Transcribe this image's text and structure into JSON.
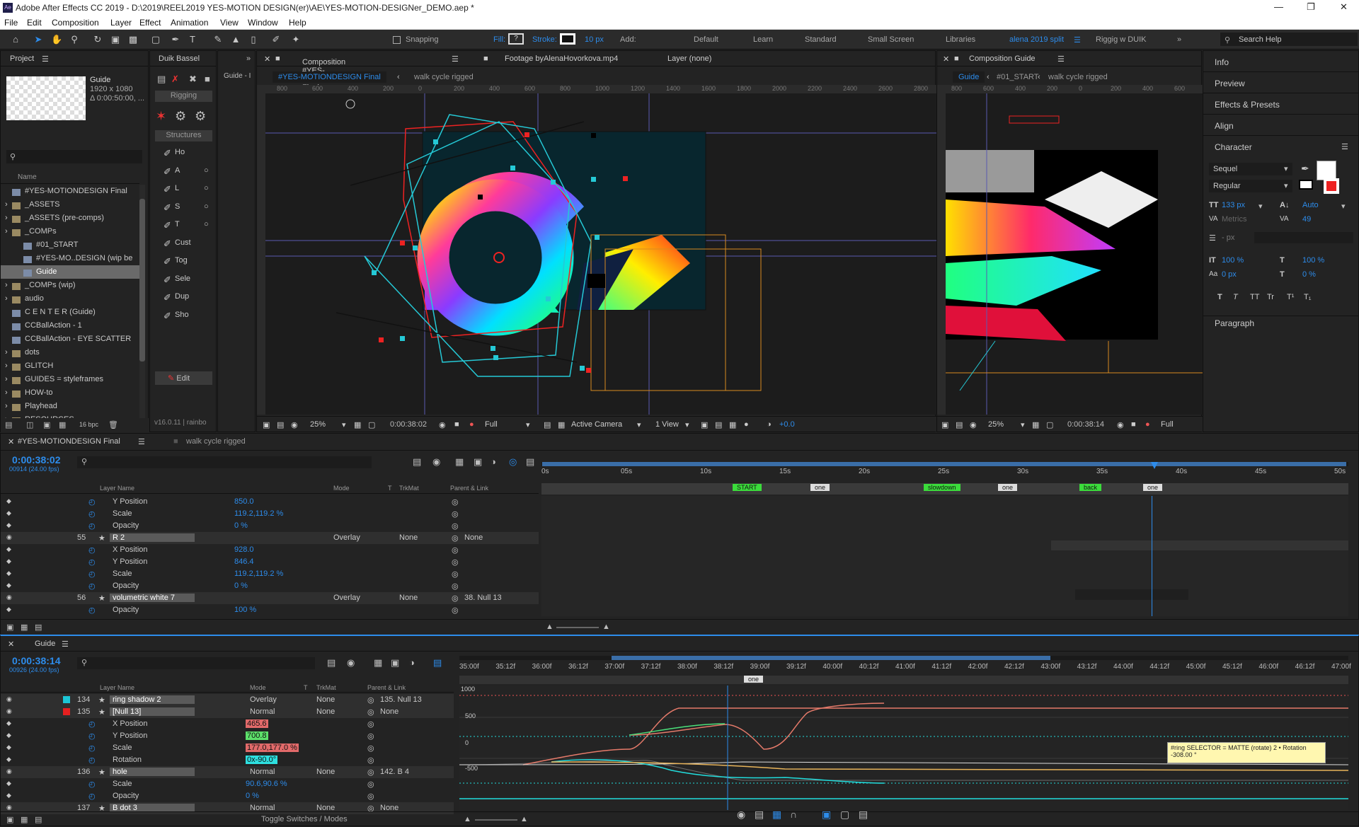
{
  "window": {
    "title": "Adobe After Effects CC 2019 - D:\\2019\\REEL2019 YES-MOTION DESIGN(er)\\AE\\YES-MOTION-DESIGNer_DEMO.aep *"
  },
  "menu": [
    "File",
    "Edit",
    "Composition",
    "Layer",
    "Effect",
    "Animation",
    "View",
    "Window",
    "Help"
  ],
  "toolbar": {
    "snapping": "Snapping",
    "fill": "Fill:",
    "stroke": "Stroke:",
    "stroke_px": "10 px",
    "add": "Add:",
    "workspaces": [
      "Default",
      "Learn",
      "Standard",
      "Small Screen",
      "Libraries",
      "alena 2019 split",
      "Riggig w DUIK"
    ],
    "search": "Search Help"
  },
  "project": {
    "title": "Project",
    "thumb_name": "Guide",
    "thumb_size": "1920 x 1080",
    "thumb_dur": "Δ 0:00:50:00, ...",
    "col_name": "Name",
    "items": [
      "#YES-MOTIONDESIGN Final",
      "_ASSETS",
      "_ASSETS (pre-comps)",
      "_COMPs",
      "#01_START",
      "#YES-MO..DESIGN (wip be",
      "Guide",
      "_COMPs (wip)",
      "audio",
      "C E N T E R (Guide)",
      "CCBallAction - 1",
      "CCBallAction - EYE  SCATTER",
      "dots",
      "GLITCH",
      "GUIDES = styleframes",
      "HOW-to",
      "Playhead",
      "RESOURCES"
    ],
    "bpc": "16 bpc"
  },
  "duik": {
    "title": "Duik Bassel",
    "rigging": "Rigging",
    "structures": "Structures",
    "tools": [
      "Ho",
      "A",
      "L",
      "S",
      "T",
      "Cust",
      "Tog",
      "Sele",
      "Dup",
      "Sho"
    ],
    "edit": "Edit",
    "version": "v16.0.11 | rainbo"
  },
  "guide_tab": "Guide - I",
  "comp_main": {
    "tabs": [
      "Composition #YES-MOTIONDESIGN Final",
      "Footage byAlenaHovorkova.mp4",
      "Layer (none)"
    ],
    "breadcrumbs": [
      "#YES-MOTIONDESIGN Final",
      "walk cycle rigged"
    ],
    "ruler": [
      "800",
      "600",
      "400",
      "200",
      "0",
      "200",
      "400",
      "600",
      "800",
      "1000",
      "1200",
      "1400",
      "1600",
      "1800",
      "2000",
      "2200",
      "2400",
      "2600",
      "2800"
    ],
    "zoom": "25%",
    "time": "0:00:38:02",
    "res": "Full",
    "camera": "Active Camera",
    "view": "1 View",
    "exposure": "+0.0"
  },
  "comp_guide": {
    "tab": "Composition Guide",
    "breadcrumbs": [
      "Guide",
      "#01_START",
      "walk cycle rigged"
    ],
    "ruler": [
      "800",
      "600",
      "400",
      "200",
      "0",
      "200",
      "400",
      "600"
    ],
    "zoom": "25%",
    "time": "0:00:38:14",
    "res": "Full"
  },
  "right_panels": {
    "items": [
      "Info",
      "Preview",
      "Effects & Presets",
      "Align",
      "Character"
    ],
    "font": "Sequel",
    "style": "Regular",
    "size": "133 px",
    "leading": "Auto",
    "metrics": "Metrics",
    "tracking": "49",
    "px": "- px",
    "vscale": "100 %",
    "hscale": "100 %",
    "baseline": "0 px",
    "tsume": "0 %",
    "styles": [
      "T",
      "T",
      "TT",
      "Tr",
      "T¹",
      "T₁"
    ],
    "paragraph": "Paragraph"
  },
  "timeline1": {
    "tab": "#YES-MOTIONDESIGN Final",
    "tab2": "walk cycle rigged",
    "time": "0:00:38:02",
    "frames": "00914 (24.00 fps)",
    "headers": {
      "name": "Layer Name",
      "mode": "Mode",
      "t": "T",
      "trk": "TrkMat",
      "parent": "Parent & Link"
    },
    "ruler": [
      "0s",
      "05s",
      "10s",
      "15s",
      "20s",
      "25s",
      "30s",
      "35s",
      "40s",
      "45s",
      "50s"
    ],
    "markers": [
      "START",
      "one",
      "slowdown",
      "one",
      "back",
      "one"
    ],
    "rows": [
      {
        "name": "Y Position",
        "value": "850.0"
      },
      {
        "name": "Scale",
        "value": "119.2,119.2 %"
      },
      {
        "name": "Opacity",
        "value": "0 %"
      },
      {
        "num": "55",
        "name": "R 2",
        "mode": "Overlay",
        "trk": "None",
        "parent": "None"
      },
      {
        "name": "X Position",
        "value": "928.0"
      },
      {
        "name": "Y Position",
        "value": "846.4"
      },
      {
        "name": "Scale",
        "value": "119.2,119.2 %"
      },
      {
        "name": "Opacity",
        "value": "0 %"
      },
      {
        "num": "56",
        "name": "volumetric white 7",
        "mode": "Overlay",
        "trk": "None",
        "parent": "38. Null 13"
      },
      {
        "name": "Opacity",
        "value": "100 %"
      }
    ]
  },
  "timeline2": {
    "tab": "Guide",
    "time": "0:00:38:14",
    "frames": "00926 (24.00 fps)",
    "ruler": [
      "35:00f",
      "35:12f",
      "36:00f",
      "36:12f",
      "37:00f",
      "37:12f",
      "38:00f",
      "38:12f",
      "39:00f",
      "39:12f",
      "40:00f",
      "40:12f",
      "41:00f",
      "41:12f",
      "42:00f",
      "42:12f",
      "43:00f",
      "43:12f",
      "44:00f",
      "44:12f",
      "45:00f",
      "45:12f",
      "46:00f",
      "46:12f",
      "47:00f"
    ],
    "marker": "one",
    "graph_labels": [
      "1000",
      "500",
      "0",
      "-500"
    ],
    "tooltip": "#ring SELECTOR = MATTE (rotate) 2 • Rotation",
    "tooltip_val": "-308.00 °",
    "toggle": "Toggle Switches / Modes",
    "rows": [
      {
        "num": "134",
        "name": "ring shadow 2",
        "mode": "Overlay",
        "trk": "None",
        "parent": "135. Null 13",
        "color": "#1bc6d6"
      },
      {
        "num": "135",
        "name": "[Null 13]",
        "mode": "Normal",
        "trk": "None",
        "parent": "None",
        "color": "#e62020"
      },
      {
        "name": "X Position",
        "value": "465.6"
      },
      {
        "name": "Y Position",
        "value": "700.8"
      },
      {
        "name": "Scale",
        "value": "177.0,177.0 %"
      },
      {
        "name": "Rotation",
        "value": "0x-90.0°"
      },
      {
        "num": "136",
        "name": "hole",
        "mode": "Normal",
        "trk": "None",
        "parent": "142. B 4"
      },
      {
        "name": "Scale",
        "value": "90.6,90.6 %"
      },
      {
        "name": "Opacity",
        "value": "0 %"
      },
      {
        "num": "137",
        "name": "B dot 3",
        "mode": "Normal",
        "trk": "None",
        "parent": "None"
      }
    ]
  },
  "colors": {
    "accent": "#2d8ceb",
    "panel": "#232323",
    "bg": "#1c1c1c"
  }
}
